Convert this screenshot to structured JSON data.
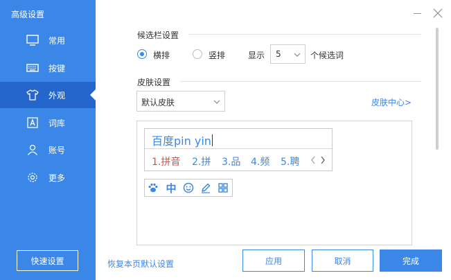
{
  "window": {
    "title": "高级设置"
  },
  "sidebar": {
    "items": [
      {
        "label": "常用",
        "icon": "monitor-icon"
      },
      {
        "label": "按键",
        "icon": "keyboard-icon"
      },
      {
        "label": "外观",
        "icon": "tshirt-icon",
        "active": true
      },
      {
        "label": "词库",
        "icon": "lexicon-a-icon"
      },
      {
        "label": "账号",
        "icon": "user-icon"
      },
      {
        "label": "更多",
        "icon": "gear-icon"
      }
    ],
    "quick_settings": "快速设置"
  },
  "candidate_bar": {
    "title": "候选栏设置",
    "options": [
      "横排",
      "竖排"
    ],
    "selected": "横排",
    "show_label": "显示",
    "count": "5",
    "count_suffix": "个候选词"
  },
  "skin": {
    "title": "皮肤设置",
    "selected": "默认皮肤",
    "center_link": "皮肤中心>"
  },
  "preview": {
    "input_prefix": "百度",
    "input_pinyin": "pin yin",
    "candidates": [
      "1.拼音",
      "2.拼",
      "3.品",
      "4.频",
      "5.聘"
    ],
    "toolbar_zh": "中"
  },
  "footer": {
    "reset": "恢复本页默认设置",
    "apply": "应用",
    "cancel": "取消",
    "done": "完成"
  },
  "colors": {
    "accent": "#3b87e8",
    "sidebar_active": "#2566cc",
    "first_candidate": "#e54a3c"
  }
}
